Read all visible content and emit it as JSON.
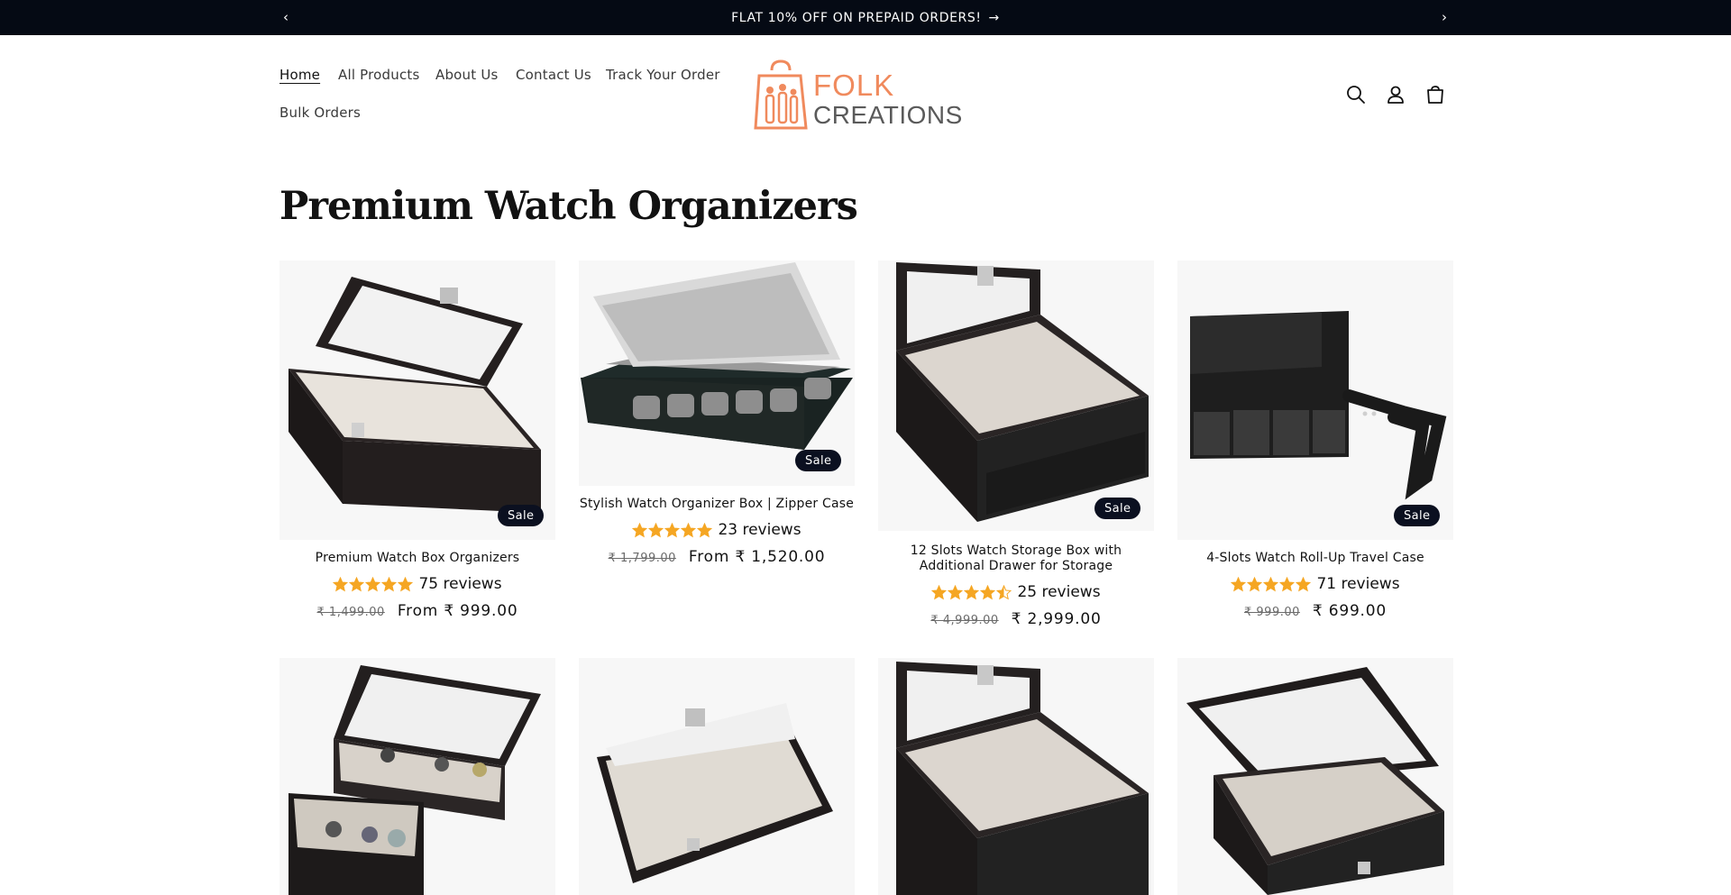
{
  "announcement": {
    "text": "FLAT 10% OFF ON PREPAID ORDERS!",
    "arrow": "→",
    "prev": "‹",
    "next": "›"
  },
  "nav": {
    "items": [
      {
        "label": "Home",
        "active": true
      },
      {
        "label": "All Products"
      },
      {
        "label": "About Us"
      },
      {
        "label": "Contact Us"
      },
      {
        "label": "Track Your Order"
      },
      {
        "label": "Bulk Orders"
      }
    ]
  },
  "brand": {
    "logo_line1": "FOLK",
    "logo_line2": "CREATIONS",
    "color": "#f08a5d",
    "text_color": "#5a5a5a"
  },
  "header_icons": [
    "search-icon",
    "account-icon",
    "cart-icon"
  ],
  "page": {
    "title": "Premium Watch Organizers"
  },
  "colors": {
    "announcement_bg": "#050a14",
    "sale_badge_bg": "#0b1020",
    "star": "#f5a623"
  },
  "products": [
    {
      "name": "Premium Watch Box Organizers",
      "rating": 5,
      "reviews": "75 reviews",
      "old_price": "₹ 1,499.00",
      "price": "From ₹ 999.00",
      "sale": "Sale"
    },
    {
      "name": "Stylish Watch Organizer Box | Zipper Case",
      "rating": 5,
      "reviews": "23 reviews",
      "old_price": "₹ 1,799.00",
      "price": "From ₹ 1,520.00",
      "sale": "Sale"
    },
    {
      "name": "12 Slots Watch Storage Box with Additional Drawer for Storage",
      "rating": 4.5,
      "reviews": "25 reviews",
      "old_price": "₹ 4,999.00",
      "price": "₹ 2,999.00",
      "sale": "Sale"
    },
    {
      "name": "4-Slots Watch Roll-Up Travel Case",
      "rating": 5,
      "reviews": "71 reviews",
      "old_price": "₹ 999.00",
      "price": "₹ 699.00",
      "sale": "Sale"
    }
  ]
}
